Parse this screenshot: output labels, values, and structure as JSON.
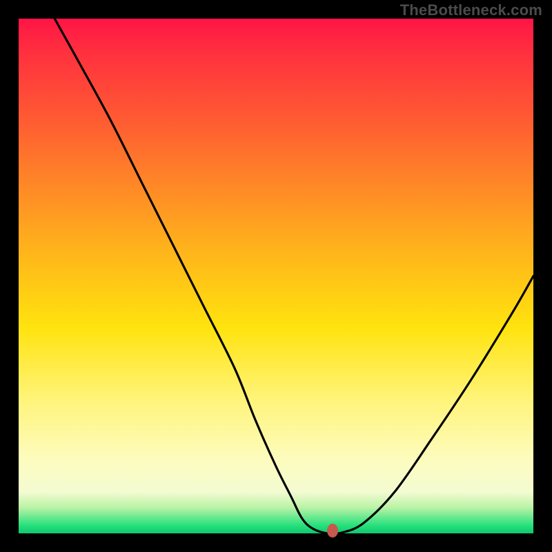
{
  "watermark": "TheBottleneck.com",
  "chart_data": {
    "type": "line",
    "title": "",
    "xlabel": "",
    "ylabel": "",
    "xlim": [
      0,
      100
    ],
    "ylim": [
      0,
      100
    ],
    "grid": false,
    "legend": false,
    "series": [
      {
        "name": "curve",
        "x": [
          7,
          12,
          18,
          24,
          30,
          36,
          42,
          46,
          50,
          53,
          55,
          57,
          60,
          63,
          67,
          73,
          80,
          88,
          96,
          100
        ],
        "y": [
          100,
          91,
          80,
          68,
          56,
          44,
          32,
          22,
          13,
          7,
          3,
          1,
          0,
          0.2,
          2,
          8,
          18,
          30,
          43,
          50
        ]
      }
    ],
    "marker": {
      "x": 61,
      "y": 0.5
    },
    "background_gradient": {
      "direction": "vertical",
      "stops": [
        {
          "pos": 0,
          "color": "#ff1546"
        },
        {
          "pos": 0.33,
          "color": "#ff8a26"
        },
        {
          "pos": 0.6,
          "color": "#ffe30e"
        },
        {
          "pos": 0.92,
          "color": "#f3fbd1"
        },
        {
          "pos": 1.0,
          "color": "#10c76f"
        }
      ]
    }
  }
}
